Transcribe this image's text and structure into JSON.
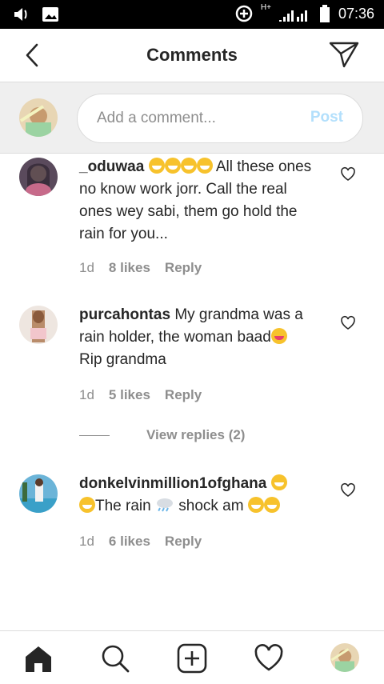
{
  "status_bar": {
    "time": "07:36",
    "network": "H+"
  },
  "header": {
    "title": "Comments"
  },
  "composer": {
    "placeholder": "Add a comment...",
    "post_label": "Post"
  },
  "comments": [
    {
      "username": "_oduwaa",
      "text_after_emojis": "All these ones no know work jorr. Call the real ones wey sabi, them go hold the rain for you...",
      "age": "1d",
      "likes": "8 likes",
      "reply": "Reply"
    },
    {
      "username": "purcahontas",
      "text_part1": "My grandma was a rain holder, the woman baad",
      "text_part2": "Rip grandma",
      "age": "1d",
      "likes": "5 likes",
      "reply": "Reply",
      "view_replies": "View replies (2)"
    },
    {
      "username": "donkelvinmillion1ofghana",
      "text_part1": "The rain",
      "text_part2": "shock am",
      "age": "1d",
      "likes": "6 likes",
      "reply": "Reply"
    }
  ],
  "colors": {
    "post_disabled": "#b2dffc",
    "secondary_text": "#8e8e8e",
    "primary_text": "#262626",
    "divider": "#dbdbdb"
  }
}
